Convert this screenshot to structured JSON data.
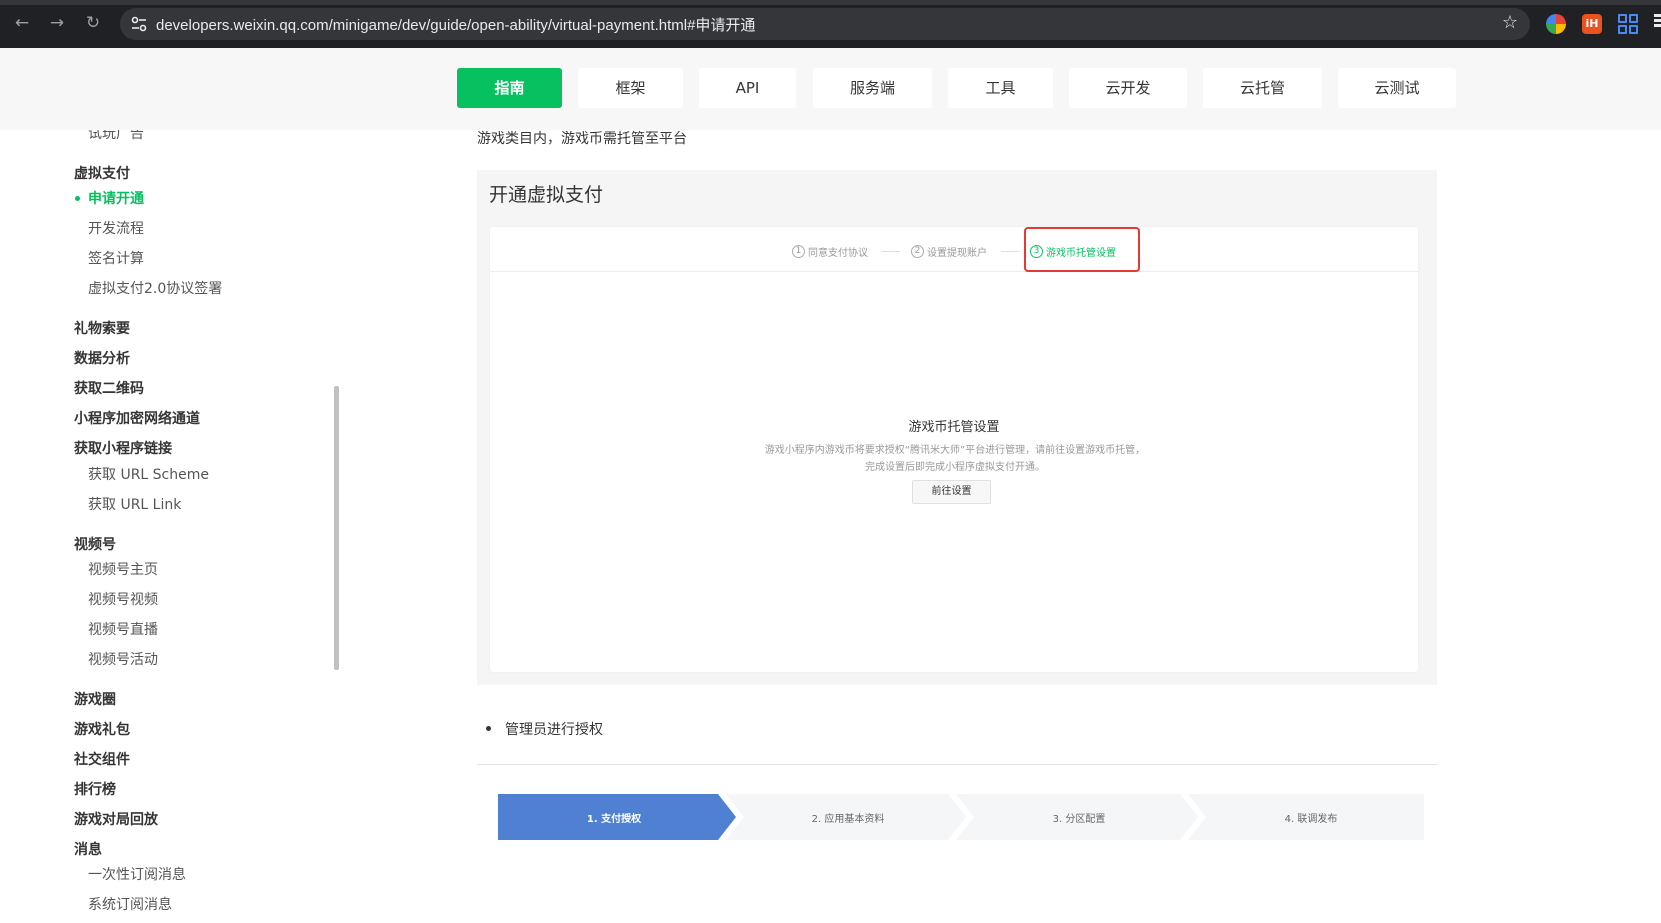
{
  "browser": {
    "url": "developers.weixin.qq.com/minigame/dev/guide/open-ability/virtual-payment.html#申请开通",
    "ext2_label": "iH"
  },
  "topnav": {
    "tabs": [
      {
        "label": "指南",
        "active": true
      },
      {
        "label": "框架"
      },
      {
        "label": "API"
      },
      {
        "label": "服务端"
      },
      {
        "label": "工具"
      },
      {
        "label": "云开发"
      },
      {
        "label": "云托管"
      },
      {
        "label": "云测试"
      }
    ]
  },
  "sidebar": {
    "items": [
      {
        "label": "试玩广告",
        "level": 2
      },
      {
        "label": "虚拟支付",
        "level": 1
      },
      {
        "label": "申请开通",
        "level": 2,
        "active": true
      },
      {
        "label": "开发流程",
        "level": 2
      },
      {
        "label": "签名计算",
        "level": 2
      },
      {
        "label": "虚拟支付2.0协议签署",
        "level": 2
      },
      {
        "label": "礼物索要",
        "level": 1
      },
      {
        "label": "数据分析",
        "level": 1
      },
      {
        "label": "获取二维码",
        "level": 1
      },
      {
        "label": "小程序加密网络通道",
        "level": 1
      },
      {
        "label": "获取小程序链接",
        "level": 1
      },
      {
        "label": "获取 URL Scheme",
        "level": 2
      },
      {
        "label": "获取 URL Link",
        "level": 2
      },
      {
        "label": "视频号",
        "level": 1
      },
      {
        "label": "视频号主页",
        "level": 2
      },
      {
        "label": "视频号视频",
        "level": 2
      },
      {
        "label": "视频号直播",
        "level": 2
      },
      {
        "label": "视频号活动",
        "level": 2
      },
      {
        "label": "游戏圈",
        "level": 1
      },
      {
        "label": "游戏礼包",
        "level": 1
      },
      {
        "label": "社交组件",
        "level": 1
      },
      {
        "label": "排行榜",
        "level": 1
      },
      {
        "label": "游戏对局回放",
        "level": 1
      },
      {
        "label": "消息",
        "level": 1
      },
      {
        "label": "一次性订阅消息",
        "level": 2
      },
      {
        "label": "系统订阅消息",
        "level": 2
      }
    ]
  },
  "content": {
    "intro": "游戏类目内，游戏币需托管至平台",
    "panel_title": "开通虚拟支付",
    "steps": [
      {
        "num": "1",
        "label": "同意支付协议"
      },
      {
        "num": "2",
        "label": "设置提现账户"
      },
      {
        "num": "3",
        "label": "游戏币托管设置",
        "current": true
      }
    ],
    "empty_title": "游戏币托管设置",
    "empty_desc": "游戏小程序内游戏币将要求授权“腾讯米大师”平台进行管理，请前往设置游戏币托管，完成设置后即完成小程序虚拟支付开通。",
    "goto_button": "前往设置",
    "bullet": "管理员进行授权",
    "flow": [
      {
        "label": "1. 支付授权",
        "active": true
      },
      {
        "label": "2. 应用基本资料"
      },
      {
        "label": "3. 分区配置"
      },
      {
        "label": "4. 联调发布"
      }
    ],
    "colors": {
      "accent": "#07c160",
      "flow_active": "#4f80d2",
      "highlight": "#e53935"
    }
  }
}
